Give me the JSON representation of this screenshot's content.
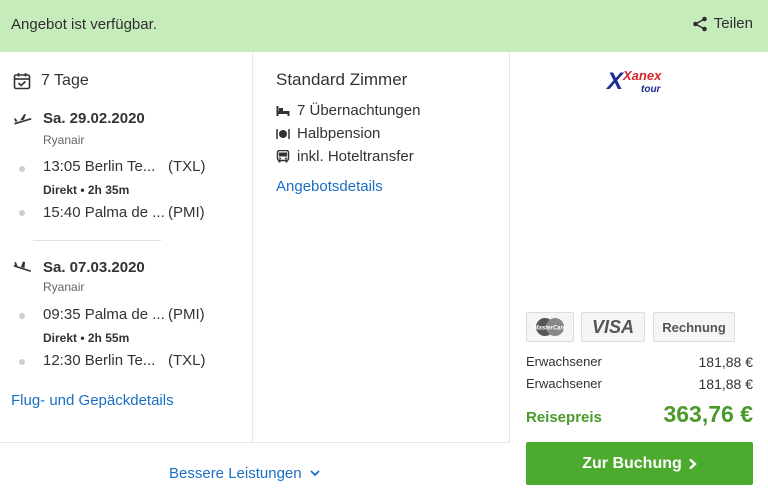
{
  "banner": {
    "status_text": "Angebot ist verfügbar.",
    "share_label": "Teilen",
    "background": "#c6ecbc"
  },
  "flight": {
    "duration_label": "7 Tage",
    "outbound": {
      "date": "Sa. 29.02.2020",
      "airline": "Ryanair",
      "departure": {
        "time_city": "13:05 Berlin Te...",
        "code": "(TXL)"
      },
      "connection": "Direkt • 2h 35m",
      "arrival": {
        "time_city": "15:40 Palma de ...",
        "code": "(PMI)"
      }
    },
    "return": {
      "date": "Sa. 07.03.2020",
      "airline": "Ryanair",
      "departure": {
        "time_city": "09:35 Palma de ...",
        "code": "(PMI)"
      },
      "connection": "Direkt • 2h 55m",
      "arrival": {
        "time_city": "12:30 Berlin Te...",
        "code": "(TXL)"
      }
    },
    "details_link": "Flug- und Gepäckdetails"
  },
  "room": {
    "title": "Standard Zimmer",
    "features": [
      {
        "icon": "bed-icon",
        "label": "7 Übernachtungen"
      },
      {
        "icon": "cutlery-icon",
        "label": "Halbpension"
      },
      {
        "icon": "bus-icon",
        "label": "inkl. Hoteltransfer"
      }
    ],
    "details_link": "Angebotsdetails"
  },
  "booking": {
    "operator_logo": {
      "line1": "Xanex",
      "line2": "tour"
    },
    "payment_methods": {
      "mastercard": "MasterCard",
      "visa": "VISA",
      "invoice": "Rechnung"
    },
    "prices": [
      {
        "label": "Erwachsener",
        "amount": "181,88 €"
      },
      {
        "label": "Erwachsener",
        "amount": "181,88 €"
      }
    ],
    "total_label": "Reisepreis",
    "total_amount": "363,76 €",
    "book_button": "Zur Buchung",
    "accent_green": "#4caa2f"
  },
  "footer": {
    "more_label": "Bessere Leistungen"
  }
}
